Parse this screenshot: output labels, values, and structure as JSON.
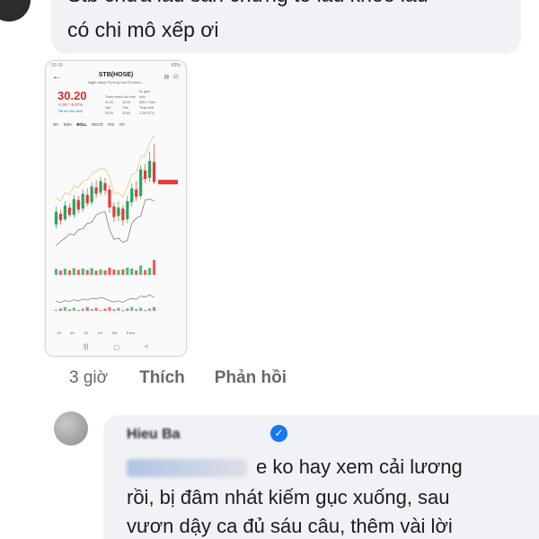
{
  "top_comment": {
    "line1": "Stb chưa lâu sẵn chứng tố lâu khỏe lâu",
    "line2": "có chi mô xếp ơi"
  },
  "screenshot": {
    "ticker": "STB(HOSE)",
    "company": "Ngân hàng Thương mại Cổ phần...",
    "status_left": "10:19",
    "status_right": "83%",
    "price": "30.20",
    "change": "-1.50 / -5.87%",
    "watch_label": "Tắt sở hữu khối",
    "info": [
      "Tham chiếu",
      "Cao nhất",
      "KL giao dịch",
      "31.00",
      "33.05",
      "806.1 Triệu",
      "Sàn",
      "Trần",
      "Thấp nhất",
      "30.00",
      "33.80",
      "2,161.6 Tỷ"
    ],
    "tabs": [
      "MA",
      "EMA",
      "BOLL",
      "MACD",
      "RSI",
      "VO"
    ],
    "active_tab": "BOLL",
    "bottom_tabs": [
      "1H",
      "4H",
      "1D",
      "1W",
      "1M",
      "Thêm"
    ],
    "nav": [
      "|||",
      "▢",
      "<"
    ],
    "chart_data": {
      "type": "candlestick",
      "candles": [
        {
          "o": 26.2,
          "c": 27.4,
          "h": 27.9,
          "l": 25.8
        },
        {
          "o": 27.2,
          "c": 26.6,
          "h": 27.6,
          "l": 26.2
        },
        {
          "o": 26.7,
          "c": 28.0,
          "h": 28.4,
          "l": 26.5
        },
        {
          "o": 27.8,
          "c": 27.1,
          "h": 28.2,
          "l": 26.9
        },
        {
          "o": 27.1,
          "c": 28.6,
          "h": 29.0,
          "l": 26.8
        },
        {
          "o": 28.5,
          "c": 27.6,
          "h": 28.9,
          "l": 27.3
        },
        {
          "o": 27.7,
          "c": 29.1,
          "h": 29.5,
          "l": 27.4
        },
        {
          "o": 29.0,
          "c": 28.2,
          "h": 29.6,
          "l": 27.9
        },
        {
          "o": 28.3,
          "c": 29.8,
          "h": 30.2,
          "l": 28.0
        },
        {
          "o": 29.7,
          "c": 29.1,
          "h": 30.4,
          "l": 28.7
        },
        {
          "o": 29.2,
          "c": 30.3,
          "h": 30.7,
          "l": 28.9
        },
        {
          "o": 30.1,
          "c": 29.4,
          "h": 30.6,
          "l": 29.0
        },
        {
          "o": 29.5,
          "c": 27.8,
          "h": 29.9,
          "l": 27.3
        },
        {
          "o": 27.9,
          "c": 26.9,
          "h": 28.3,
          "l": 26.4
        },
        {
          "o": 27.0,
          "c": 27.8,
          "h": 28.4,
          "l": 26.5
        },
        {
          "o": 27.7,
          "c": 26.6,
          "h": 28.0,
          "l": 26.1
        },
        {
          "o": 26.7,
          "c": 28.4,
          "h": 28.9,
          "l": 26.3
        },
        {
          "o": 28.3,
          "c": 29.6,
          "h": 30.1,
          "l": 27.9
        },
        {
          "o": 29.5,
          "c": 28.8,
          "h": 30.3,
          "l": 28.4
        },
        {
          "o": 28.9,
          "c": 31.4,
          "h": 31.8,
          "l": 28.6
        },
        {
          "o": 31.3,
          "c": 30.5,
          "h": 31.9,
          "l": 30.1
        },
        {
          "o": 30.6,
          "c": 32.2,
          "h": 33.1,
          "l": 30.2
        },
        {
          "o": 32.1,
          "c": 30.2,
          "h": 33.8,
          "l": 30.0
        }
      ],
      "up_color": "#26a65b",
      "down_color": "#e53935"
    }
  },
  "actions": {
    "time": "3 giờ",
    "like": "Thích",
    "reply": "Phản hồi"
  },
  "reply": {
    "name": "Hieu Ba",
    "line1": "e ko hay xem cải lương",
    "line2": "rồi, bị đâm nhát kiếm gục xuống, sau",
    "line3": "vươn dậy ca đủ sáu câu, thêm vài lời"
  },
  "colors": {
    "bubble": "#f0f2f5",
    "meta_text": "#65676b",
    "verified": "#1877f2",
    "price_down": "#d32f2f"
  }
}
